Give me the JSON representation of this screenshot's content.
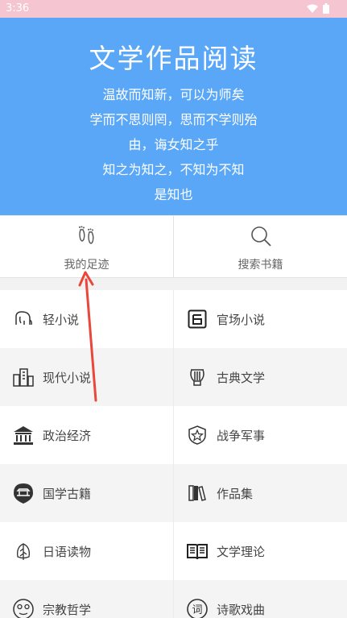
{
  "status": {
    "time": "3:36"
  },
  "header": {
    "title": "文学作品阅读",
    "poem": [
      "温故而知新，可以为师矣",
      "学而不思则罔，思而不学则殆",
      "由，诲女知之乎",
      "知之为知之，不知为不知",
      "是知也"
    ]
  },
  "quick": {
    "footprint_label": "我的足迹",
    "search_label": "搜索书籍"
  },
  "categories": [
    {
      "label": "轻小说",
      "icon": "elephant-icon"
    },
    {
      "label": "官场小说",
      "icon": "official-seal-icon"
    },
    {
      "label": "现代小说",
      "icon": "buildings-icon"
    },
    {
      "label": "古典文学",
      "icon": "lyre-icon"
    },
    {
      "label": "政治经济",
      "icon": "government-building-icon"
    },
    {
      "label": "战争军事",
      "icon": "star-shield-icon"
    },
    {
      "label": "国学古籍",
      "icon": "pagoda-icon"
    },
    {
      "label": "作品集",
      "icon": "books-icon"
    },
    {
      "label": "日语读物",
      "icon": "leaf-icon"
    },
    {
      "label": "文学理论",
      "icon": "open-book-icon"
    },
    {
      "label": "宗教哲学",
      "icon": "face-icon"
    },
    {
      "label": "诗歌戏曲",
      "icon": "ci-character-icon"
    }
  ],
  "colors": {
    "header": "#5aa7f8",
    "status_bar": "#f5c6d2",
    "arrow": "#e8473a"
  }
}
